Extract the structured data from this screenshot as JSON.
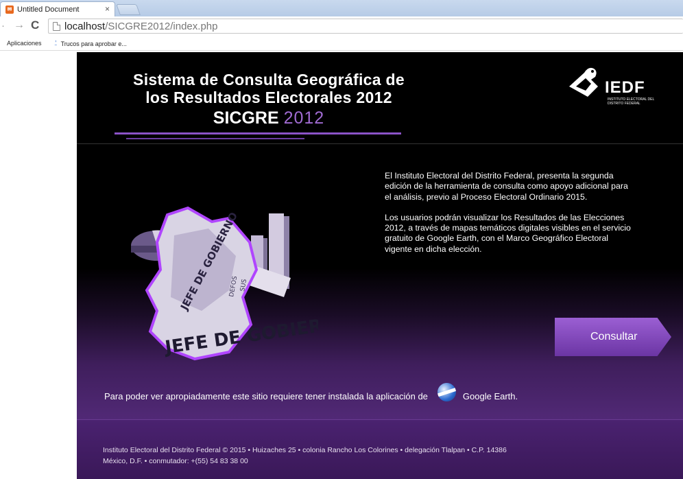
{
  "browser": {
    "tab_title": "Untitled Document",
    "tab_close": "×",
    "url_host": "localhost",
    "url_path": "/SICGRE2012/index.php",
    "bookmarks": [
      "Aplicaciones",
      "Trucos para aprobar e..."
    ]
  },
  "header": {
    "title_line1": "Sistema de Consulta Geográfica de",
    "title_line2": "los Resultados Electorales 2012",
    "brand_a": "SICGRE",
    "brand_b": "2012",
    "logo_text": "IEDF",
    "logo_sub": "INSTITUTO ELECTORAL DEL DISTRITO FEDERAL"
  },
  "intro": {
    "paragraph1": "El Instituto Electoral del Distrito Federal, presenta la segunda edición de la herramienta de consulta como apoyo adicional para el análisis, previo al Proceso Electoral Ordinario 2015.",
    "paragraph2": "Los usuarios podrán visualizar los Resultados de las Elecciones 2012, a través de mapas temáticos digitales visibles en el servicio gratuito de Google Earth, con el Marco Geográfico Electoral vigente en dicha elección."
  },
  "illustration": {
    "text1": "JEFE DE GOBIERNO",
    "text2": "JEFE DE GOBIERNO",
    "text3": "DEFOS",
    "text4": "SUS"
  },
  "cta": {
    "label": "Consultar"
  },
  "requirement": {
    "text": "Para poder ver apropiadamente este sitio requiere tener instalada la aplicación de",
    "app": "Google Earth."
  },
  "footer": {
    "line1": "Instituto Electoral del Distrito Federal © 2015 • Huizaches 25 • colonia Rancho Los Colorines • delegación Tlalpan • C.P. 14386",
    "line2": "México, D.F. • conmutador: +(55) 54 83 38 00"
  },
  "colors": {
    "accent": "#8b53c7",
    "button": "#7a42b8",
    "footer": "#3f1c60"
  }
}
